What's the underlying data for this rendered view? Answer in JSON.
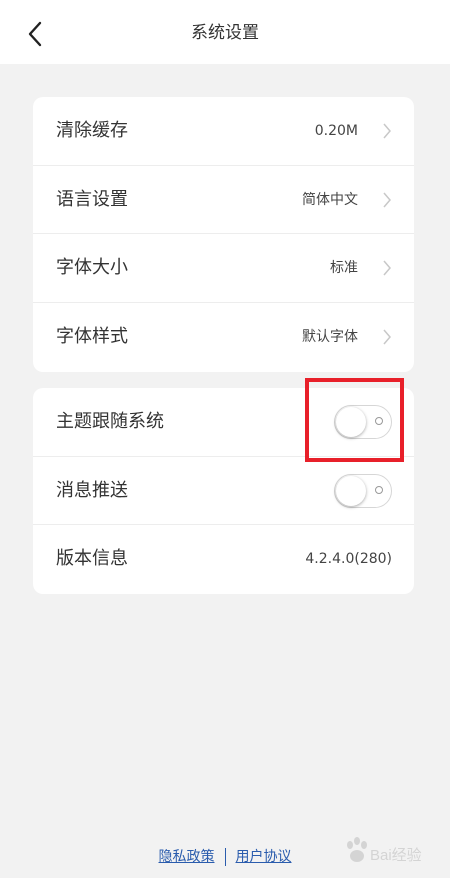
{
  "header": {
    "title": "系统设置",
    "back_icon": "chevron-left-icon"
  },
  "settings_group1": [
    {
      "label": "清除缓存",
      "value": "0.20M"
    },
    {
      "label": "语言设置",
      "value": "简体中文"
    },
    {
      "label": "字体大小",
      "value": "标准"
    },
    {
      "label": "字体样式",
      "value": "默认字体"
    }
  ],
  "settings_group2": {
    "theme_follow": {
      "label": "主题跟随系统",
      "state": "off"
    },
    "push": {
      "label": "消息推送",
      "state": "off"
    },
    "version": {
      "label": "版本信息",
      "value": "4.2.4.0(280)"
    }
  },
  "footer": {
    "privacy": "隐私政策",
    "agreement": "用户协议"
  },
  "watermark": {
    "text": "Bai经验"
  },
  "colors": {
    "background": "#f2f2f2",
    "card": "#ffffff",
    "highlight": "#e8202a",
    "link": "#2a5cad"
  }
}
